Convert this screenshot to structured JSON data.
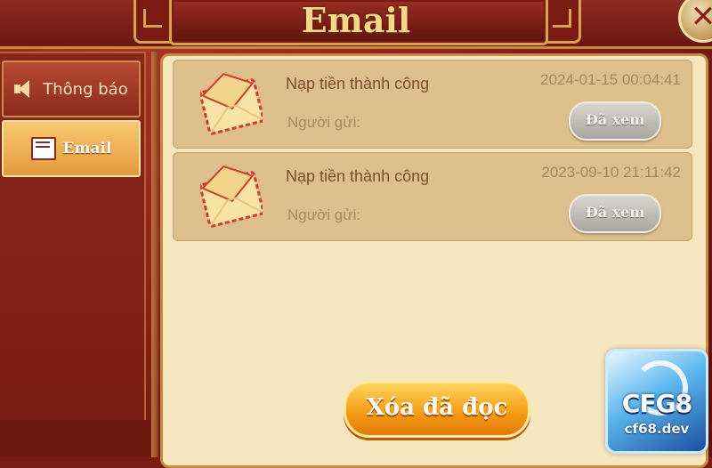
{
  "header": {
    "title": "Email",
    "close_label": "✕"
  },
  "sidebar": {
    "items": [
      {
        "label": "Thông báo",
        "icon": "speaker-icon",
        "active": false
      },
      {
        "label": "Email",
        "icon": "mail-icon",
        "active": true
      }
    ]
  },
  "mails": [
    {
      "subject": "Nạp tiền thành công",
      "date": "2024-01-15 00:04:41",
      "sender_label": "Người gửi:",
      "status_label": "Đã xem"
    },
    {
      "subject": "Nạp tiền thành công",
      "date": "2023-09-10 21:11:42",
      "sender_label": "Người gửi:",
      "status_label": "Đã xem"
    }
  ],
  "footer": {
    "delete_read_label": "Xóa đã đọc"
  },
  "watermark": {
    "brand": "CFG8",
    "site": "cf68.dev"
  },
  "colors": {
    "accent": "#f39a14",
    "frame": "#7a1a14",
    "panel": "#f6e6bf",
    "card": "#ddbf8b"
  }
}
